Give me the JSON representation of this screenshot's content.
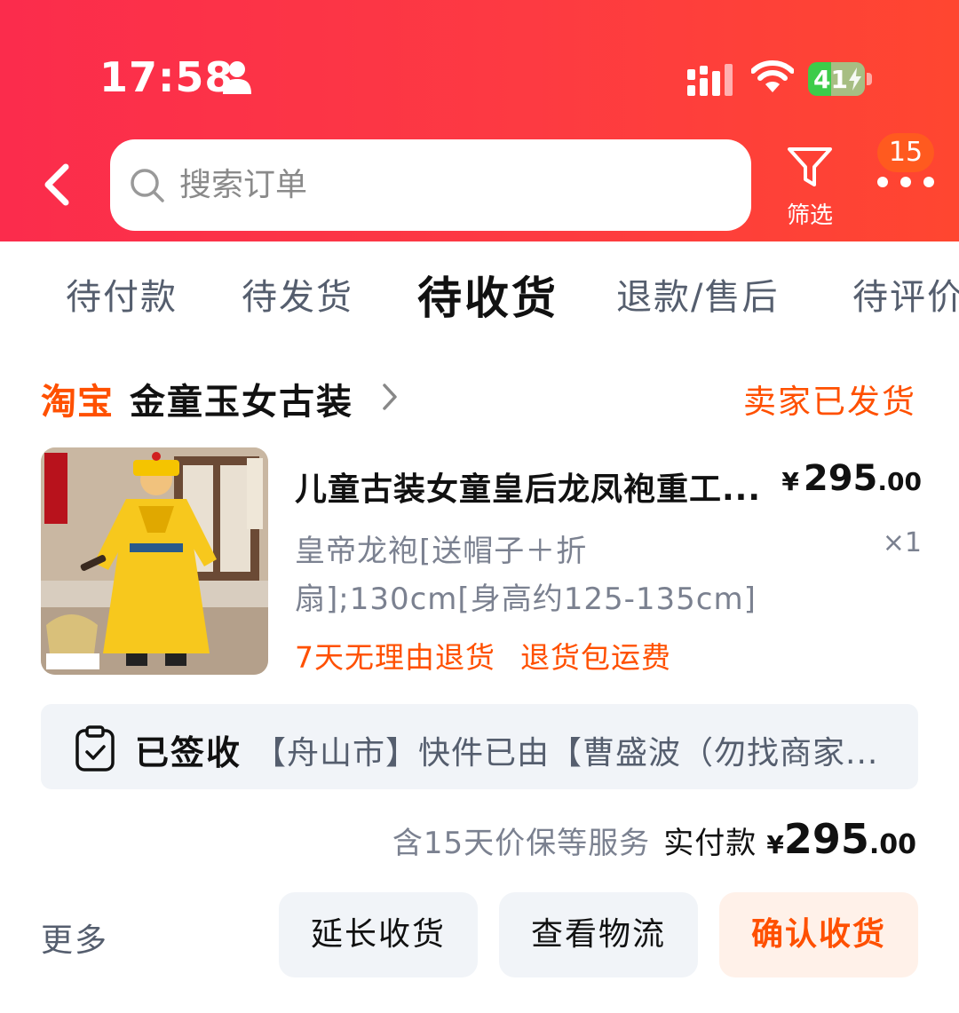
{
  "status_bar": {
    "time": "17:58",
    "battery": "41",
    "battery_level_pct": 41,
    "icons": [
      "person-icon",
      "signal-icon",
      "wifi-icon",
      "battery-icon"
    ]
  },
  "header": {
    "search_placeholder": "搜索订单",
    "filter_label": "筛选",
    "notification_count": "15"
  },
  "tabs": [
    {
      "label": "待付款",
      "active": false
    },
    {
      "label": "待发货",
      "active": false
    },
    {
      "label": "待收货",
      "active": true
    },
    {
      "label": "退款/售后",
      "active": false
    },
    {
      "label": "待评价",
      "active": false
    }
  ],
  "order": {
    "platform": "淘宝",
    "shop_name": "金童玉女古装",
    "status": "卖家已发货",
    "product": {
      "title": "儿童古装女童皇后龙凤袍重工...",
      "price_currency": "¥",
      "price_int": "295",
      "price_dec": ".00",
      "sku": "皇帝龙袍[送帽子＋折扇];130cm[身高约125-135cm]",
      "quantity": "×1",
      "tags": [
        "7天无理由退货",
        "退货包运费"
      ]
    },
    "logistics": {
      "status": "已签收",
      "detail": "【舟山市】快件已由【曹盛波（勿找商家..."
    },
    "summary": {
      "service_note": "含15天价保等服务",
      "paid_label": "实付款",
      "currency": "¥",
      "amount_int": "295",
      "amount_dec": ".00"
    },
    "actions": {
      "more": "更多",
      "extend": "延长收货",
      "track": "查看物流",
      "confirm": "确认收货"
    }
  },
  "colors": {
    "header_gradient_start": "#fb2c4c",
    "header_gradient_end": "#ff4630",
    "accent_orange": "#ff5000",
    "badge_orange": "#ff5a1f",
    "battery_green": "#3ccc4a",
    "button_gray": "#f1f4f8",
    "button_primary_bg": "#fff1e9"
  }
}
